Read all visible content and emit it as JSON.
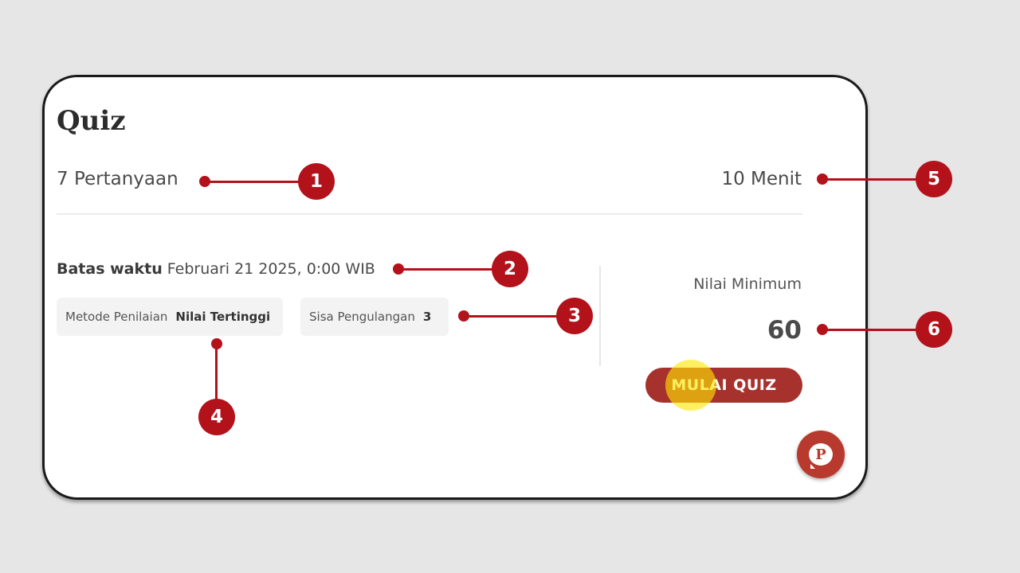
{
  "quiz": {
    "title": "Quiz",
    "question_count": "7 Pertanyaan",
    "duration": "10 Menit",
    "deadline_label": "Batas waktu",
    "deadline_value": "Februari 21 2025, 0:00 WIB",
    "grading_method_label": "Metode Penilaian",
    "grading_method_value": "Nilai Tertinggi",
    "remaining_attempts_label": "Sisa Pengulangan",
    "remaining_attempts_value": "3",
    "min_score_label": "Nilai Minimum",
    "min_score_value": "60",
    "start_button_label": "MULAI QUIZ"
  },
  "help_fab": {
    "icon": "chat-p-icon",
    "glyph": "P"
  },
  "annotations": [
    "1",
    "2",
    "3",
    "4",
    "5",
    "6"
  ],
  "colors": {
    "accent": "#a6312d",
    "annotation": "#b3121b",
    "background": "#e6e6e6",
    "cursor_highlight": "#ffe600"
  }
}
